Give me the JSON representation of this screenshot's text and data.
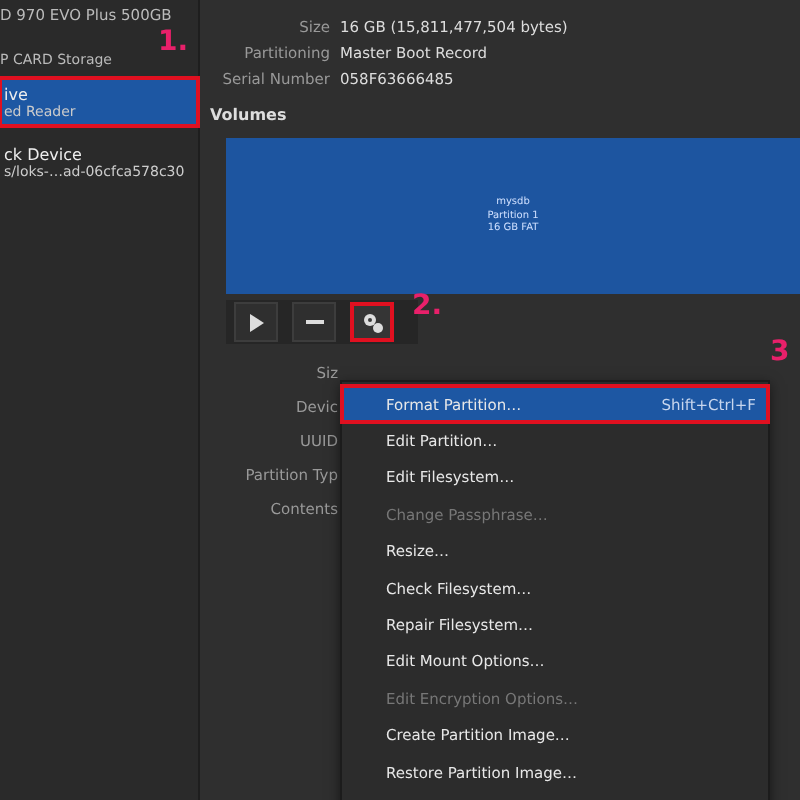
{
  "sidebar": {
    "items": [
      {
        "kind": "subtitle",
        "text": "D 970 EVO Plus 500GB"
      },
      {
        "kind": "heading",
        "text": "P CARD Storage"
      },
      {
        "kind": "device",
        "title": "ive",
        "subtitle": "ed Reader",
        "selected": true,
        "highlighted": true
      },
      {
        "kind": "device",
        "title": "ck Device",
        "subtitle": "s/loks-…ad-06cfca578c30",
        "selected": false,
        "highlighted": false
      }
    ]
  },
  "drive_info": [
    {
      "label": "Size",
      "value": "16 GB (15,811,477,504 bytes)"
    },
    {
      "label": "Partitioning",
      "value": "Master Boot Record"
    },
    {
      "label": "Serial Number",
      "value": "058F63666485"
    }
  ],
  "volumes": {
    "title": "Volumes",
    "partition": {
      "lines": [
        "mysdb",
        "Partition 1",
        "16 GB FAT"
      ]
    },
    "toolbar": [
      {
        "kind": "play",
        "highlighted": false
      },
      {
        "kind": "minus",
        "highlighted": false
      },
      {
        "kind": "gears",
        "highlighted": true
      }
    ]
  },
  "partition_info": [
    "Siz",
    "Devic",
    "UUID",
    "Partition Typ",
    "Contents"
  ],
  "menu": [
    {
      "label": "Format Partition…",
      "shortcut": "Shift+Ctrl+F",
      "selected": true,
      "disabled": false
    },
    {
      "label": "Edit Partition…",
      "selected": false,
      "disabled": false
    },
    {
      "label": "Edit Filesystem…",
      "selected": false,
      "disabled": false
    },
    {
      "label": "Change Passphrase…",
      "selected": false,
      "disabled": true
    },
    {
      "label": "Resize…",
      "selected": false,
      "disabled": false
    },
    {
      "label": "Check Filesystem…",
      "selected": false,
      "disabled": false
    },
    {
      "label": "Repair Filesystem…",
      "selected": false,
      "disabled": false
    },
    {
      "label": "Edit Mount Options…",
      "selected": false,
      "disabled": false
    },
    {
      "label": "Edit Encryption Options…",
      "selected": false,
      "disabled": true
    },
    {
      "label": "Create Partition Image…",
      "selected": false,
      "disabled": false
    },
    {
      "label": "Restore Partition Image…",
      "selected": false,
      "disabled": false
    }
  ],
  "annotations": [
    "1.",
    "2.",
    "3"
  ]
}
